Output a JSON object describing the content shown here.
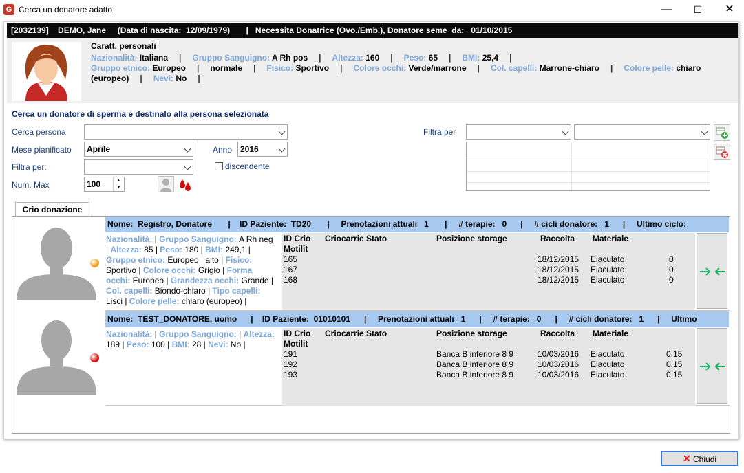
{
  "window": {
    "title": "Cerca un donatore adatto",
    "minimize": "—",
    "maximize": "☐",
    "close": "✕"
  },
  "patient_header": {
    "text": "[2032139]    DEMO, Jane     (Data di nascita:  12/09/1979)       |   Necessita Donatrice (Ovo./Emb.), Donatore seme  da:   01/10/2015"
  },
  "patient": {
    "section": "Caratt. personali",
    "nazionalita_label": "Nazionalità:",
    "nazionalita": "Italiana",
    "gruppo_label": "Gruppo Sanguigno:",
    "gruppo": "A Rh pos",
    "altezza_label": "Altezza:",
    "altezza": "160",
    "peso_label": "Peso:",
    "peso": "65",
    "bmi_label": "BMI:",
    "bmi": "25,4",
    "etnico_label": "Gruppo etnico:",
    "etnico": "Europeo",
    "normale": "normale",
    "fisico_label": "Fisico:",
    "fisico": "Sportivo",
    "occhi_label": "Colore occhi:",
    "occhi": "Verde/marrone",
    "capelli_label": "Col. capelli:",
    "capelli": "Marrone-chiaro",
    "pelle_label": "Colore pelle:",
    "pelle_a": "chiaro",
    "pelle_b": "(europeo)",
    "nevi_label": "Nevi:",
    "nevi": "No",
    "sep": "|"
  },
  "search": {
    "title": "Cerca un donatore di sperma e destinalo alla persona selezionata",
    "cerca_label": "Cerca persona",
    "cerca_value": "",
    "mese_label": "Mese pianificato",
    "mese_value": "Aprile",
    "anno_label": "Anno",
    "anno_value": "2016",
    "filtra_label": "Filtra per:",
    "filtra_value": "",
    "discendente_label": "discendente",
    "nummax_label": "Num. Max",
    "nummax_value": "100",
    "filtra_per_label": "Filtra per",
    "filtra_a": "",
    "filtra_b": ""
  },
  "tab": {
    "label": "Crio donazione"
  },
  "columns": {
    "id": "ID Crio",
    "motilit": "Motilit",
    "criocarrie": "Criocarrie Stato",
    "posizione": "Posizione storage",
    "raccolta": "Raccolta",
    "materiale": "Materiale"
  },
  "donors": [
    {
      "header": "Nome:  Registro, Donatore       |    ID Paziente:  TD20       |     Prenotazioni attuali   1       |     # terapie:   0      |     # cicli donatore:   1      |     Ultimo ciclo:",
      "status_color": "#f5a01a",
      "info": [
        [
          [
            "l",
            "Nazionalità:"
          ],
          [
            "t",
            "  |  "
          ],
          [
            "l",
            "Gruppo Sanguigno: "
          ],
          [
            "t",
            "A Rh neg"
          ]
        ],
        [
          [
            "t",
            "| "
          ],
          [
            "l",
            "Altezza: "
          ],
          [
            "t",
            "85  | "
          ],
          [
            "l",
            "Peso: "
          ],
          [
            "t",
            "180  | "
          ],
          [
            "l",
            "BMI: "
          ],
          [
            "t",
            "249,1  |"
          ]
        ],
        [
          [
            "l",
            "Gruppo etnico: "
          ],
          [
            "t",
            "Europeo  | alto  | "
          ],
          [
            "l",
            "Fisico:"
          ]
        ],
        [
          [
            "t",
            "Sportivo  | "
          ],
          [
            "l",
            "Colore occhi: "
          ],
          [
            "t",
            "Grigio  | "
          ],
          [
            "l",
            "Forma"
          ]
        ],
        [
          [
            "l",
            "occhi: "
          ],
          [
            "t",
            "Europeo  | "
          ],
          [
            "l",
            "Grandezza occhi: "
          ],
          [
            "t",
            "Grande  |"
          ]
        ],
        [
          [
            "l",
            "Col. capelli: "
          ],
          [
            "t",
            "Biondo-chiaro  | "
          ],
          [
            "l",
            "Tipo capelli:"
          ]
        ],
        [
          [
            "t",
            "Lisci  | "
          ],
          [
            "l",
            "Colore pelle: "
          ],
          [
            "t",
            "chiaro (europeo)  |"
          ]
        ]
      ],
      "rows": [
        {
          "id": "165",
          "posizione": "",
          "raccolta": "18/12/2015",
          "materiale": "Eiaculato",
          "val": "0"
        },
        {
          "id": "167",
          "posizione": "",
          "raccolta": "18/12/2015",
          "materiale": "Eiaculato",
          "val": "0"
        },
        {
          "id": "168",
          "posizione": "",
          "raccolta": "18/12/2015",
          "materiale": "Eiaculato",
          "val": "0"
        }
      ]
    },
    {
      "header": "Nome:  TEST_DONATORE, uomo      |    ID Paziente:  01010101      |     Prenotazioni attuali   1      |     # terapie:   0      |     # cicli donatore:   1      |     Ultimo",
      "status_color": "#e01010",
      "info": [
        [
          [
            "l",
            "Nazionalità:"
          ],
          [
            "t",
            "  |  "
          ],
          [
            "l",
            "Gruppo Sanguigno:"
          ],
          [
            "t",
            "  |  "
          ],
          [
            "l",
            "Altezza:"
          ]
        ],
        [
          [
            "t",
            "189  | "
          ],
          [
            "l",
            "Peso: "
          ],
          [
            "t",
            "100  | "
          ],
          [
            "l",
            "BMI: "
          ],
          [
            "t",
            "28  | "
          ],
          [
            "l",
            "Nevi: "
          ],
          [
            "t",
            "No  |"
          ]
        ]
      ],
      "rows": [
        {
          "id": "191",
          "posizione": "Banca B inferiore 8 9",
          "raccolta": "10/03/2016",
          "materiale": "Eiaculato",
          "val": "0,15"
        },
        {
          "id": "192",
          "posizione": "Banca B inferiore 8 9",
          "raccolta": "10/03/2016",
          "materiale": "Eiaculato",
          "val": "0,15"
        },
        {
          "id": "193",
          "posizione": "Banca B inferiore 8 9",
          "raccolta": "10/03/2016",
          "materiale": "Eiaculato",
          "val": "0,15"
        }
      ]
    }
  ],
  "footer": {
    "close_label": "Chiudi"
  }
}
